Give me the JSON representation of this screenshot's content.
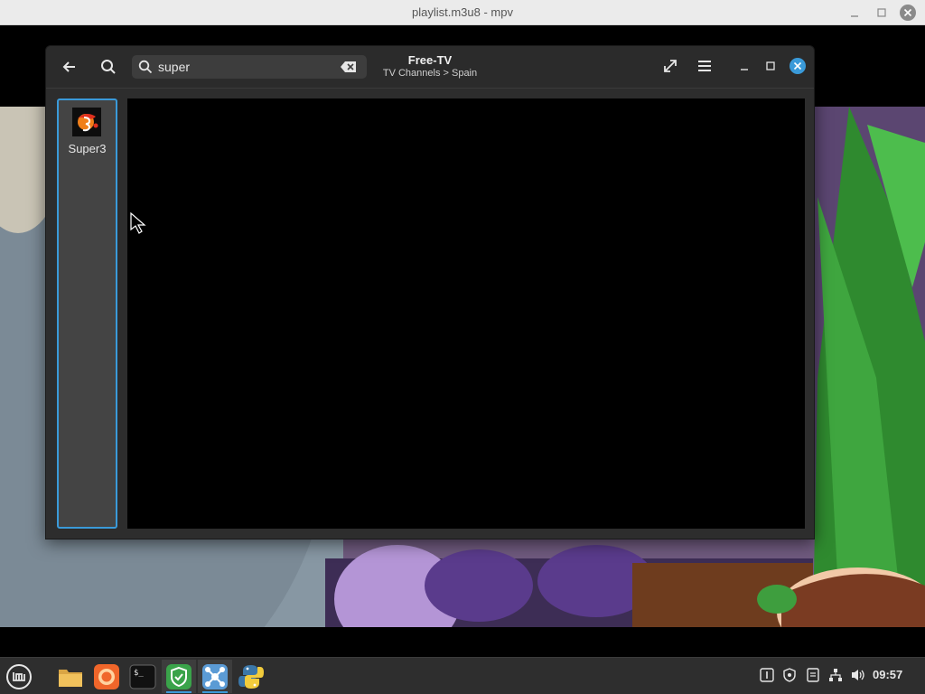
{
  "mpv_window": {
    "title": "playlist.m3u8 - mpv"
  },
  "dialog": {
    "title": "Free-TV",
    "subtitle": "TV Channels > Spain",
    "search": {
      "value": "super",
      "placeholder": ""
    },
    "channels": [
      {
        "label": "Super3",
        "icon": "super3-logo"
      }
    ],
    "selected_channel_index": 0
  },
  "header_icons": [
    "back-arrow-icon",
    "search-icon",
    "fullscreen-icon",
    "hamburger-menu-icon",
    "minimize-icon",
    "maximize-icon",
    "close-icon"
  ],
  "taskbar": {
    "items": [
      "mint-menu-icon",
      "files-icon",
      "firefox-icon",
      "terminal-icon",
      "shield-vpn-icon",
      "network-app-icon",
      "python-icon"
    ],
    "tray": [
      "keyboard-layout-icon",
      "shield-tray-icon",
      "notes-tray-icon",
      "network-tray-icon",
      "volume-icon"
    ],
    "clock": "09:57"
  },
  "colors": {
    "accent": "#3a9ad9",
    "dialog_bg": "#2d2d2d",
    "titlebar_bg": "#ebebeb",
    "taskbar_bg": "#2e2e2e"
  }
}
